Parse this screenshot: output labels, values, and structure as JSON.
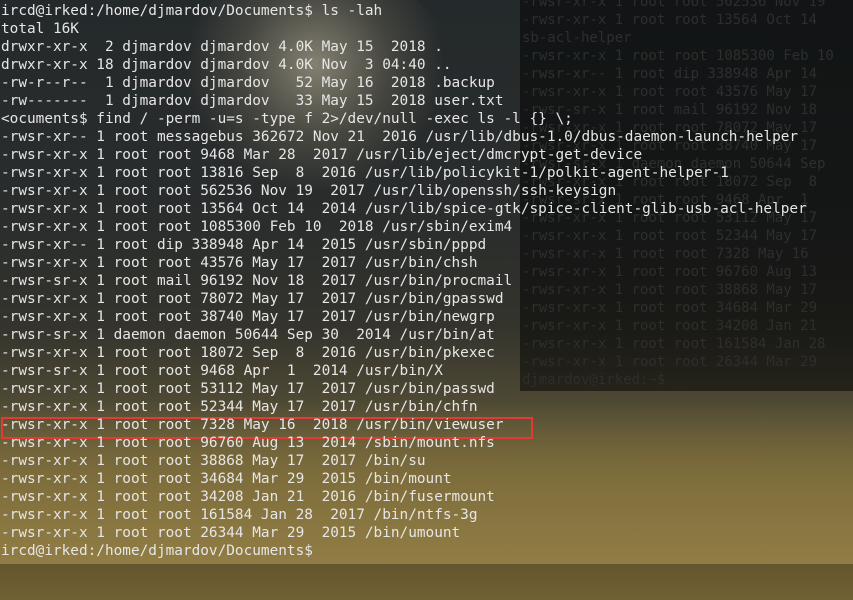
{
  "background_terminal": {
    "lines": [
      "-rwsr-xr-x 1 root root 562536 Nov 19",
      "-rwsr-xr-x 1 root root 13564 Oct 14",
      "sb-acl-helper",
      "-rwsr-xr-x 1 root root 1085300 Feb 10",
      "-rwsr-xr-- 1 root dip 338948 Apr 14",
      "-rwsr-xr-x 1 root root 43576 May 17",
      "-rwsr-sr-x 1 root mail 96192 Nov 18",
      "-rwsr-xr-x 1 root root 78072 May 17",
      "-rwsr-xr-x 1 root root 38740 May 17",
      "-rwsr-sr-x 1 daemon daemon 50644 Sep",
      "-rwsr-xr-x 1 root root 18072 Sep  8",
      "-rwsr-sr-x 1 root root 9468 Apr  1",
      "-rwsr-xr-x 1 root root 53112 May 17",
      "-rwsr-xr-x 1 root root 52344 May 17",
      "-rwsr-xr-x 1 root root 7328 May 16",
      "-rwsr-xr-x 1 root root 96760 Aug 13",
      "-rwsr-xr-x 1 root root 38868 May 17",
      "-rwsr-xr-x 1 root root 34684 Mar 29",
      "-rwsr-xr-x 1 root root 34208 Jan 21",
      "-rwsr-xr-x 1 root root 161584 Jan 28",
      "-rwsr-xr-x 1 root root 26344 Mar 29",
      "djmardov@irked:~$ _"
    ]
  },
  "terminal": {
    "lines": [
      "ircd@irked:/home/djmardov/Documents$ ls -lah",
      "total 16K",
      "drwxr-xr-x  2 djmardov djmardov 4.0K May 15  2018 .",
      "drwxr-xr-x 18 djmardov djmardov 4.0K Nov  3 04:40 ..",
      "-rw-r--r--  1 djmardov djmardov   52 May 16  2018 .backup",
      "-rw-------  1 djmardov djmardov   33 May 15  2018 user.txt",
      "<ocuments$ find / -perm -u=s -type f 2>/dev/null -exec ls -l {} \\;",
      "-rwsr-xr-- 1 root messagebus 362672 Nov 21  2016 /usr/lib/dbus-1.0/dbus-daemon-launch-helper",
      "-rwsr-xr-x 1 root root 9468 Mar 28  2017 /usr/lib/eject/dmcrypt-get-device",
      "-rwsr-xr-x 1 root root 13816 Sep  8  2016 /usr/lib/policykit-1/polkit-agent-helper-1",
      "-rwsr-xr-x 1 root root 562536 Nov 19  2017 /usr/lib/openssh/ssh-keysign",
      "-rwsr-xr-x 1 root root 13564 Oct 14  2014 /usr/lib/spice-gtk/spice-client-glib-usb-acl-helper",
      "-rwsr-xr-x 1 root root 1085300 Feb 10  2018 /usr/sbin/exim4",
      "-rwsr-xr-- 1 root dip 338948 Apr 14  2015 /usr/sbin/pppd",
      "-rwsr-xr-x 1 root root 43576 May 17  2017 /usr/bin/chsh",
      "-rwsr-sr-x 1 root mail 96192 Nov 18  2017 /usr/bin/procmail",
      "-rwsr-xr-x 1 root root 78072 May 17  2017 /usr/bin/gpasswd",
      "-rwsr-xr-x 1 root root 38740 May 17  2017 /usr/bin/newgrp",
      "-rwsr-sr-x 1 daemon daemon 50644 Sep 30  2014 /usr/bin/at",
      "-rwsr-xr-x 1 root root 18072 Sep  8  2016 /usr/bin/pkexec",
      "-rwsr-sr-x 1 root root 9468 Apr  1  2014 /usr/bin/X",
      "-rwsr-xr-x 1 root root 53112 May 17  2017 /usr/bin/passwd",
      "-rwsr-xr-x 1 root root 52344 May 17  2017 /usr/bin/chfn",
      "-rwsr-xr-x 1 root root 7328 May 16  2018 /usr/bin/viewuser",
      "-rwsr-xr-x 1 root root 96760 Aug 13  2014 /sbin/mount.nfs",
      "-rwsr-xr-x 1 root root 38868 May 17  2017 /bin/su",
      "-rwsr-xr-x 1 root root 34684 Mar 29  2015 /bin/mount",
      "-rwsr-xr-x 1 root root 34208 Jan 21  2016 /bin/fusermount",
      "-rwsr-xr-x 1 root root 161584 Jan 28  2017 /bin/ntfs-3g",
      "-rwsr-xr-x 1 root root 26344 Mar 29  2015 /bin/umount",
      "ircd@irked:/home/djmardov/Documents$ "
    ],
    "highlighted_line_index": 23
  },
  "colors": {
    "terminal_text": "#e6e6e6",
    "highlight_border": "#e53935",
    "background_terminal_text": "#2e2e2e"
  }
}
